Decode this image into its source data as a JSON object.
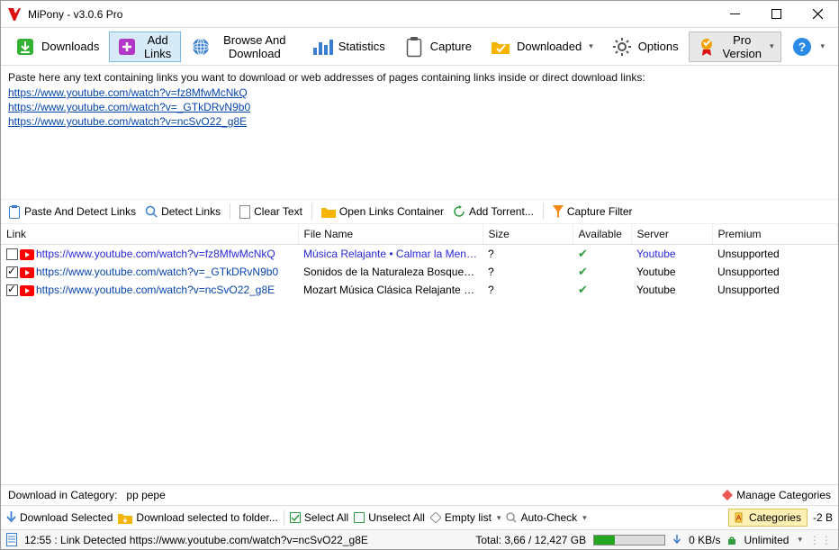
{
  "title": "MiPony - v3.0.6 Pro",
  "toolbar": {
    "downloads": "Downloads",
    "addlinks": "Add Links",
    "browse": "Browse And Download",
    "statistics": "Statistics",
    "capture": "Capture",
    "downloaded": "Downloaded",
    "options": "Options",
    "pro": "Pro Version"
  },
  "hint": "Paste here any text containing links you want to download or web addresses of pages containing links inside or direct download links:",
  "paste_links": [
    "https://www.youtube.com/watch?v=fz8MfwMcNkQ",
    "https://www.youtube.com/watch?v=_GTkDRvN9b0",
    "https://www.youtube.com/watch?v=ncSvO22_g8E"
  ],
  "actions": {
    "paste_detect": "Paste And Detect Links",
    "detect": "Detect Links",
    "clear": "Clear Text",
    "open_container": "Open Links Container",
    "add_torrent": "Add Torrent...",
    "capture_filter": "Capture Filter"
  },
  "columns": {
    "link": "Link",
    "filename": "File Name",
    "size": "Size",
    "available": "Available",
    "server": "Server",
    "premium": "Premium"
  },
  "rows": [
    {
      "checked": false,
      "link": "https://www.youtube.com/watch?v=fz8MfwMcNkQ",
      "filename": "Música Relajante • Calmar la Mente, ...",
      "size": "?",
      "available": true,
      "server": "Youtube",
      "premium": "Unsupported"
    },
    {
      "checked": true,
      "link": "https://www.youtube.com/watch?v=_GTkDRvN9b0",
      "filename": "Sonidos de la Naturaleza Bosque Rel...",
      "size": "?",
      "available": true,
      "server": "Youtube",
      "premium": "Unsupported"
    },
    {
      "checked": true,
      "link": "https://www.youtube.com/watch?v=ncSvO22_g8E",
      "filename": "Mozart Música Clásica Relajante para ...",
      "size": "?",
      "available": true,
      "server": "Youtube",
      "premium": "Unsupported"
    }
  ],
  "catbar": {
    "label": "Download in Category:",
    "cats": "pp   pepe",
    "manage": "Manage Categories"
  },
  "botbar": {
    "download_selected": "Download Selected",
    "download_folder": "Download selected to folder...",
    "select_all": "Select All",
    "unselect_all": "Unselect All",
    "empty_list": "Empty list",
    "auto_check": "Auto-Check",
    "categories": "Categories",
    "minus2b": "-2 B"
  },
  "status": {
    "msg": "12:55 : Link Detected https://www.youtube.com/watch?v=ncSvO22_g8E",
    "total": "Total: 3,66 / 12,427 GB",
    "speed": "0 KB/s",
    "unlimited": "Unlimited"
  }
}
